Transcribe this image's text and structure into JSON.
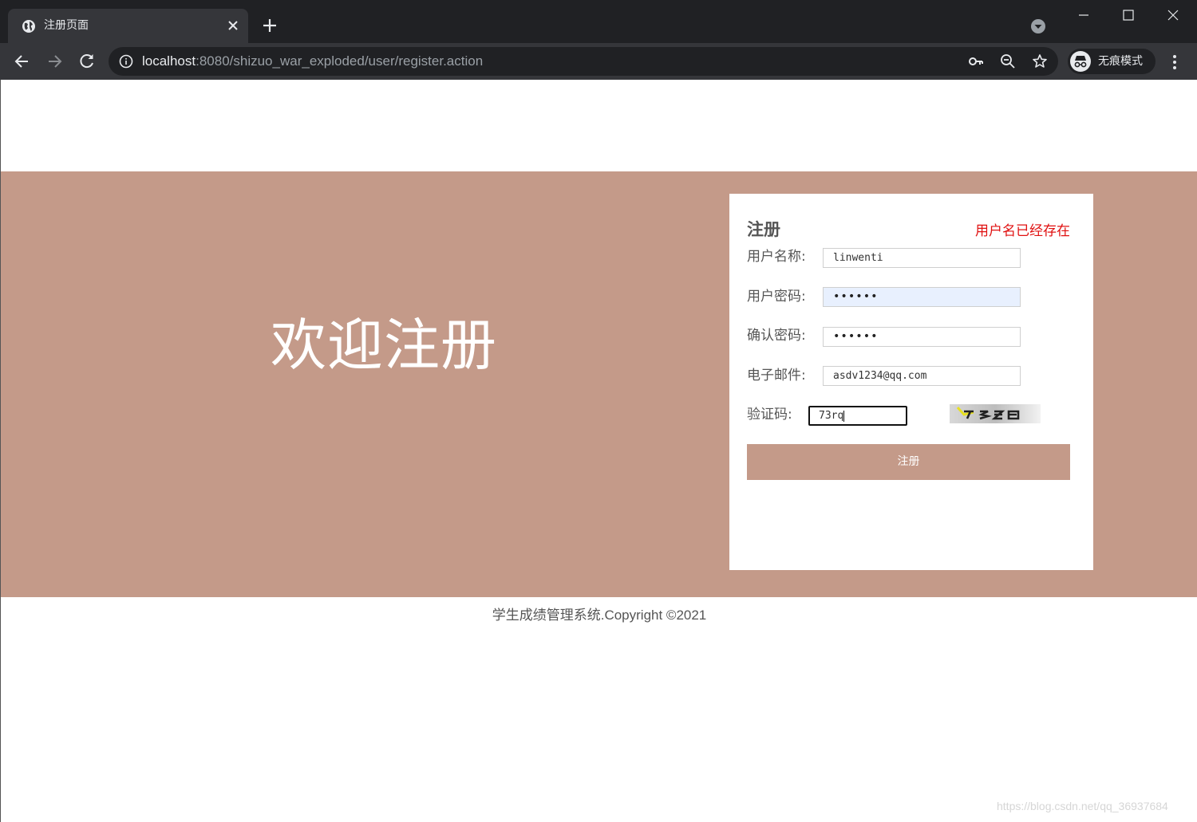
{
  "browser": {
    "tab_title": "注册页面",
    "url_host": "localhost",
    "url_rest": ":8080/shizuo_war_exploded/user/register.action",
    "incognito_label": "无痕模式"
  },
  "page": {
    "welcome_text": "欢迎注册",
    "form": {
      "title": "注册",
      "error": "用户名已经存在",
      "fields": [
        {
          "label": "用户名称:",
          "value": "linwenti"
        },
        {
          "label": "用户密码:",
          "value": "••••••"
        },
        {
          "label": "确认密码:",
          "value": "••••••"
        },
        {
          "label": "电子邮件:",
          "value": "asdv1234@qq.com"
        }
      ],
      "captcha_label": "验证码:",
      "captcha_value": "73rq",
      "submit_label": "注册"
    },
    "footer": "学生成绩管理系统.Copyright ©2021",
    "watermark": "https://blog.csdn.net/qq_36937684"
  },
  "colors": {
    "accent": "#c49a89",
    "error": "#e01010",
    "chrome_dark": "#202124",
    "chrome_toolbar": "#35363a"
  }
}
